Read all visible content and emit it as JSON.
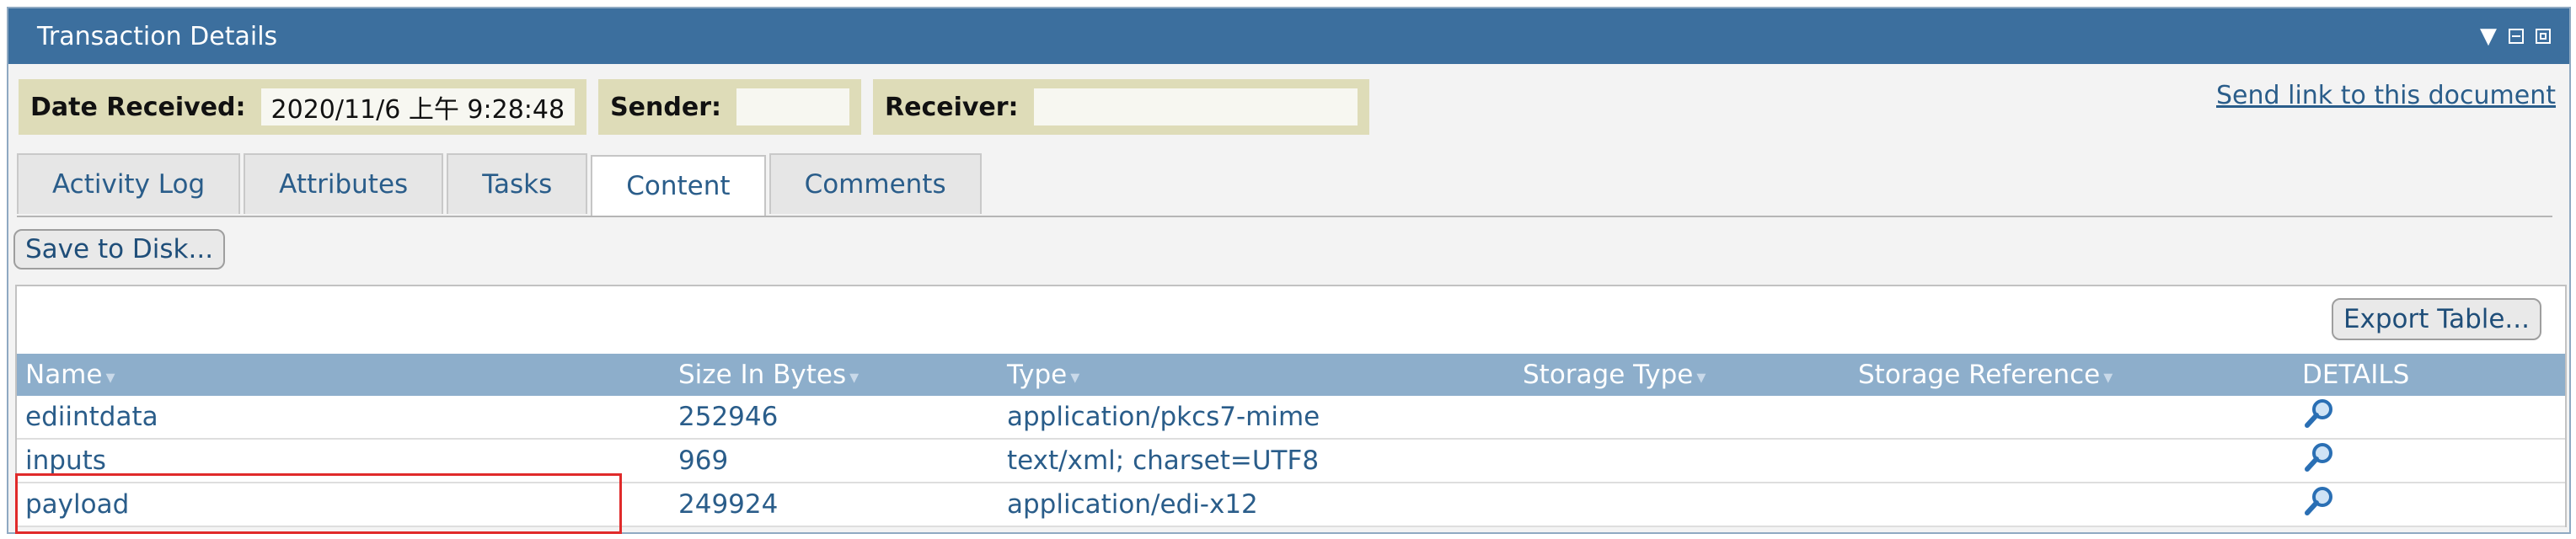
{
  "window": {
    "title": "Transaction Details",
    "controls": [
      "dropdown-icon",
      "minimize-icon",
      "maximize-icon"
    ]
  },
  "meta": {
    "date_received_label": "Date Received:",
    "date_received_value": "2020/11/6 上午 9:28:48",
    "sender_label": "Sender:",
    "receiver_label": "Receiver:"
  },
  "send_link": "Send link to this document",
  "tabs": [
    {
      "label": "Activity Log",
      "active": false
    },
    {
      "label": "Attributes",
      "active": false
    },
    {
      "label": "Tasks",
      "active": false
    },
    {
      "label": "Content",
      "active": true
    },
    {
      "label": "Comments",
      "active": false
    }
  ],
  "buttons": {
    "save_to_disk": "Save to Disk...",
    "export_table": "Export Table..."
  },
  "table": {
    "headers": [
      "Name",
      "Size In Bytes",
      "Type",
      "Storage Type",
      "Storage Reference",
      "DETAILS"
    ],
    "rows": [
      {
        "name": "ediintdata",
        "size": "252946",
        "type": "application/pkcs7-mime",
        "storage_type": "",
        "storage_ref": ""
      },
      {
        "name": "inputs",
        "size": "969",
        "type": "text/xml; charset=UTF8",
        "storage_type": "",
        "storage_ref": ""
      },
      {
        "name": "payload",
        "size": "249924",
        "type": "application/edi-x12",
        "storage_type": "",
        "storage_ref": ""
      }
    ]
  },
  "colors": {
    "titlebar": "#3c6f9e",
    "header_row": "#8daecb",
    "meta_chip": "#dedcb8",
    "highlight": "#e02a2a"
  }
}
